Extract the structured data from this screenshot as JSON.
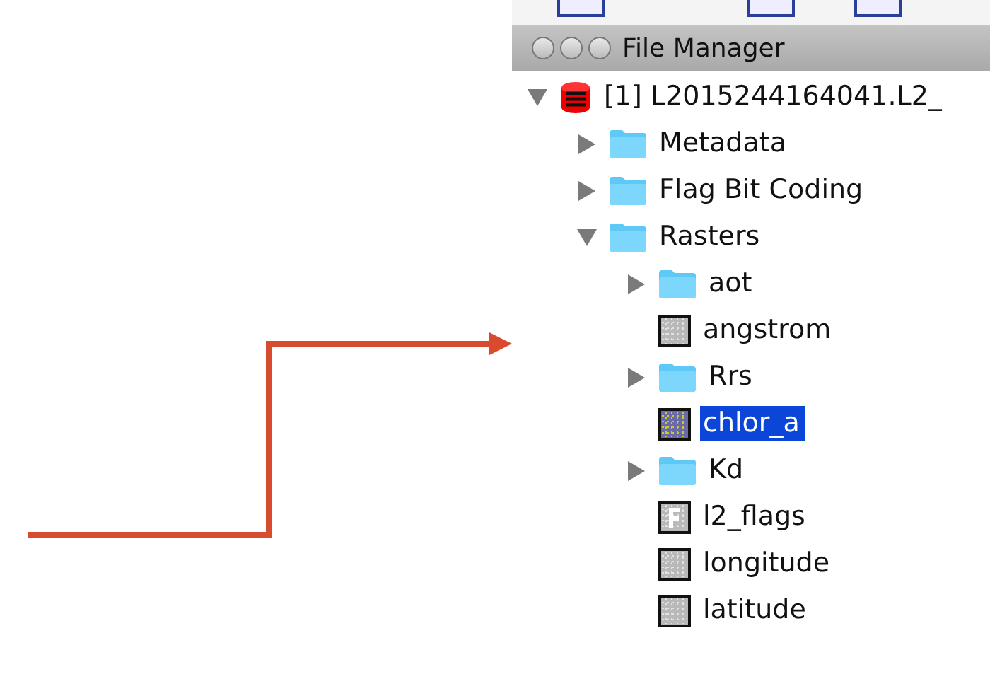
{
  "window": {
    "title": "File Manager"
  },
  "tree": [
    {
      "label": "[1] L2015244164041.L2_",
      "kind": "product",
      "expanded": true,
      "selected": false,
      "children": [
        {
          "label": "Metadata",
          "kind": "folder",
          "expanded": false,
          "selected": false
        },
        {
          "label": "Flag Bit Coding",
          "kind": "folder",
          "expanded": false,
          "selected": false
        },
        {
          "label": "Rasters",
          "kind": "folder",
          "expanded": true,
          "selected": false,
          "children": [
            {
              "label": "aot",
              "kind": "folder",
              "expanded": false,
              "selected": false
            },
            {
              "label": "angstrom",
              "kind": "band",
              "selected": false
            },
            {
              "label": "Rrs",
              "kind": "folder",
              "expanded": false,
              "selected": false
            },
            {
              "label": "chlor_a",
              "kind": "color-band",
              "selected": true
            },
            {
              "label": "Kd",
              "kind": "folder",
              "expanded": false,
              "selected": false
            },
            {
              "label": "l2_flags",
              "kind": "flag-band",
              "selected": false
            },
            {
              "label": "longitude",
              "kind": "band",
              "selected": false
            },
            {
              "label": "latitude",
              "kind": "band",
              "selected": false
            }
          ]
        }
      ]
    }
  ]
}
